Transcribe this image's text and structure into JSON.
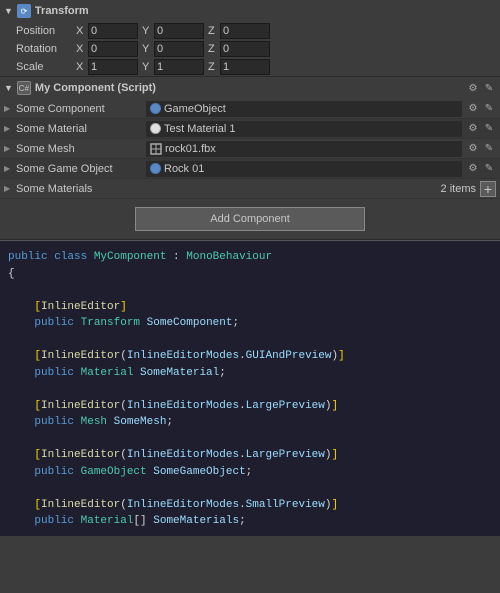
{
  "transform": {
    "header_title": "Transform",
    "position_label": "Position",
    "rotation_label": "Rotation",
    "scale_label": "Scale",
    "fields": {
      "position": {
        "x": "0",
        "y": "0",
        "z": "0"
      },
      "rotation": {
        "x": "0",
        "y": "0",
        "z": "0"
      },
      "scale": {
        "x": "1",
        "y": "1",
        "z": "1"
      }
    }
  },
  "component": {
    "header_title": "My Component (Script)",
    "rows": [
      {
        "label": "Some Component",
        "value": "GameObject",
        "type": "gameobject"
      },
      {
        "label": "Some Material",
        "value": "Test Material 1",
        "type": "material"
      },
      {
        "label": "Some Mesh",
        "value": "rock01.fbx",
        "type": "mesh"
      },
      {
        "label": "Some Game Object",
        "value": "Rock 01",
        "type": "gameobject"
      },
      {
        "label": "Some Materials",
        "value": "2 items",
        "type": "array"
      }
    ],
    "add_button_label": "Add Component"
  },
  "code": {
    "lines": [
      {
        "type": "keyword_class",
        "text": "public class MyComponent : MonoBehaviour"
      },
      {
        "type": "brace",
        "text": "{"
      },
      {
        "type": "blank",
        "text": ""
      },
      {
        "type": "attr",
        "text": "    [InlineEditor]"
      },
      {
        "type": "field",
        "text": "    public Transform SomeComponent;"
      },
      {
        "type": "blank",
        "text": ""
      },
      {
        "type": "attr",
        "text": "    [InlineEditor(InlineEditorModes.GUIAndPreview)]"
      },
      {
        "type": "field",
        "text": "    public Material SomeMaterial;"
      },
      {
        "type": "blank",
        "text": ""
      },
      {
        "type": "attr",
        "text": "    [InlineEditor(InlineEditorModes.LargePreview)]"
      },
      {
        "type": "field",
        "text": "    public Mesh SomeMesh;"
      },
      {
        "type": "blank",
        "text": ""
      },
      {
        "type": "attr",
        "text": "    [InlineEditor(InlineEditorModes.LargePreview)]"
      },
      {
        "type": "field",
        "text": "    public GameObject SomeGameObject;"
      },
      {
        "type": "blank",
        "text": ""
      },
      {
        "type": "attr",
        "text": "    [InlineEditor(InlineEditorModes.SmallPreview)]"
      },
      {
        "type": "field",
        "text": "    public Material[] SomeMaterials;"
      },
      {
        "type": "blank",
        "text": ""
      },
      {
        "type": "brace",
        "text": "}"
      }
    ]
  }
}
